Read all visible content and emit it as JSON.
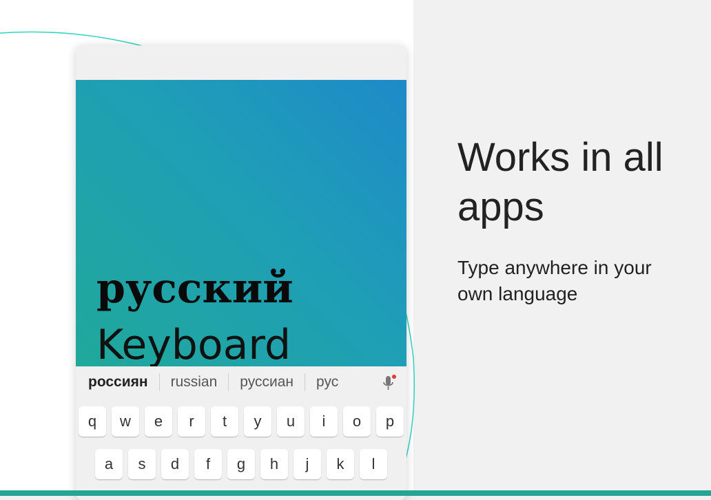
{
  "hero": {
    "title_ru": "русский",
    "title_en": "Keyboard"
  },
  "suggestions": [
    "россиян",
    "russian",
    "руссиан",
    "рус"
  ],
  "mic": {
    "icon": "mic-icon"
  },
  "keyboard": {
    "row1": [
      "q",
      "w",
      "e",
      "r",
      "t",
      "y",
      "u",
      "i",
      "o",
      "p"
    ],
    "row2": [
      "a",
      "s",
      "d",
      "f",
      "g",
      "h",
      "j",
      "k",
      "l"
    ]
  },
  "promo": {
    "headline": "Works in all apps",
    "subline": "Type anywhere in your own language"
  },
  "colors": {
    "accent": "#24a596",
    "gradient_start": "#20a89a",
    "gradient_end": "#1e8ac8"
  }
}
